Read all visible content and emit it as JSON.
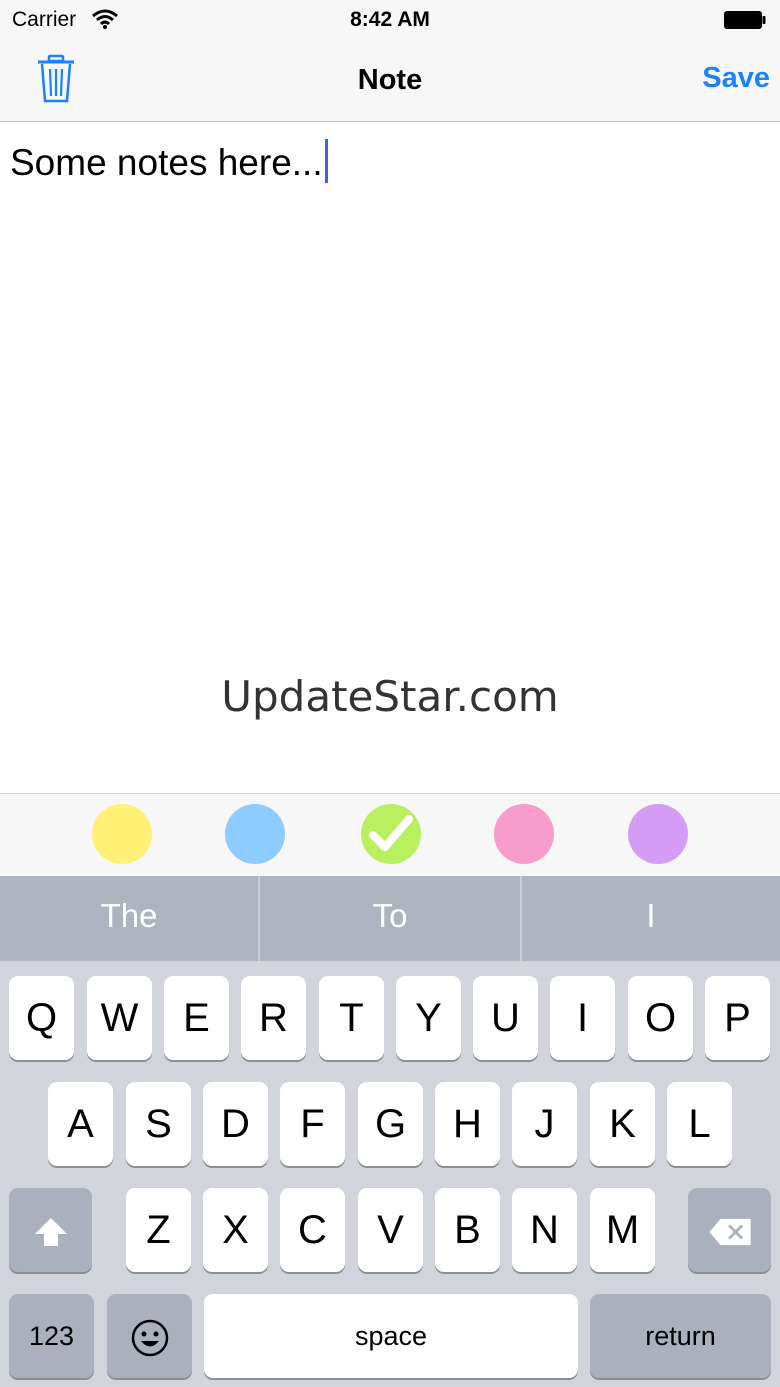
{
  "status_bar": {
    "carrier": "Carrier",
    "time": "8:42 AM"
  },
  "nav": {
    "title": "Note",
    "save_label": "Save",
    "trash_icon": "trash-icon"
  },
  "note": {
    "text": "Some notes here..."
  },
  "watermark": "UpdateStar.com",
  "colors": [
    {
      "name": "yellow",
      "hex": "#fff176",
      "selected": false
    },
    {
      "name": "blue",
      "hex": "#8ecbff",
      "selected": false
    },
    {
      "name": "green",
      "hex": "#b8f060",
      "selected": true
    },
    {
      "name": "pink",
      "hex": "#f79ccb",
      "selected": false
    },
    {
      "name": "purple",
      "hex": "#d59cf5",
      "selected": false
    }
  ],
  "predictions": [
    "The",
    "To",
    "I"
  ],
  "keyboard": {
    "row1": [
      "Q",
      "W",
      "E",
      "R",
      "T",
      "Y",
      "U",
      "I",
      "O",
      "P"
    ],
    "row2": [
      "A",
      "S",
      "D",
      "F",
      "G",
      "H",
      "J",
      "K",
      "L"
    ],
    "row3": [
      "Z",
      "X",
      "C",
      "V",
      "B",
      "N",
      "M"
    ],
    "numbers_label": "123",
    "space_label": "space",
    "return_label": "return"
  }
}
